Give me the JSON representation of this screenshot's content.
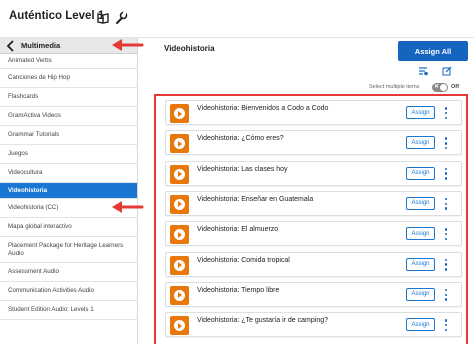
{
  "app": {
    "title": "Auténtico Level 1"
  },
  "toolbar": {
    "icons": [
      "book-icon",
      "wrench-icon"
    ]
  },
  "sidebar": {
    "header_label": "Multimedia",
    "items": [
      {
        "label": "Animated Verbs",
        "active": false
      },
      {
        "label": "Canciones de Hip Hop",
        "active": false
      },
      {
        "label": "Flashcards",
        "active": false
      },
      {
        "label": "GramActiva Videos",
        "active": false
      },
      {
        "label": "Grammar Tutorials",
        "active": false
      },
      {
        "label": "Juegos",
        "active": false
      },
      {
        "label": "Videocultura",
        "active": false
      },
      {
        "label": "Videohistoria",
        "active": true
      },
      {
        "label": "Videohistoria (CC)",
        "active": false
      },
      {
        "label": "Mapa global interactivo",
        "active": false
      },
      {
        "label": "Placement Package for Heritage Learners Audio",
        "active": false
      },
      {
        "label": "Assessment Audio",
        "active": false
      },
      {
        "label": "Communication Activities Audio",
        "active": false
      },
      {
        "label": "Student Edition Audio: Levels 1",
        "active": false
      }
    ]
  },
  "main": {
    "title": "Videohistoria",
    "assign_all_label": "Assign All",
    "select_multiple_label": "Select multiple items",
    "toggle_state": "Off",
    "assign_label": "Assign",
    "items": [
      "Videohistoria: Bienvenidos a Codo a Codo",
      "Videohistoria: ¿Cómo eres?",
      "Videohistoria: Las clases hoy",
      "Videohistoria: Enseñar en Guatemala",
      "Videohistoria: El almuerzo",
      "Videohistoria: Comida tropical",
      "Videohistoria: Tiempo libre",
      "Videohistoria: ¿Te gustaría ir de camping?"
    ]
  },
  "colors": {
    "accent": "#1565c0",
    "active_item": "#1976d2",
    "play_orange": "#e8780c",
    "annotation_red": "#e53935"
  }
}
